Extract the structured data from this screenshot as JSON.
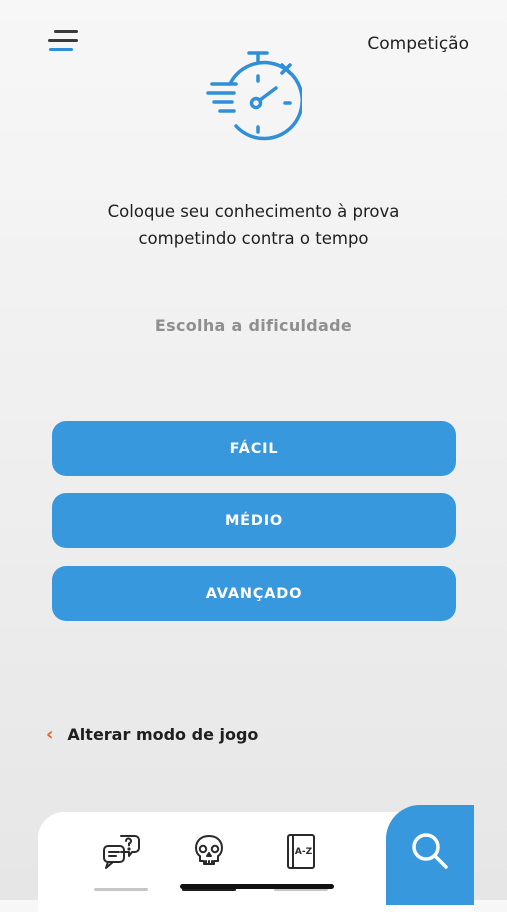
{
  "header": {
    "mode_title": "Competição",
    "menu_icon": "menu-icon"
  },
  "hero": {
    "icon": "stopwatch-icon",
    "tagline_line1": "Coloque seu conhecimento à prova",
    "tagline_line2": "competindo contra o tempo"
  },
  "difficulty": {
    "label": "Escolha a dificuldade",
    "options": [
      {
        "label": "FÁCIL"
      },
      {
        "label": "MÉDIO"
      },
      {
        "label": "AVANÇADO"
      }
    ]
  },
  "footer_link": {
    "icon": "chevron-left-icon",
    "label": "Alterar modo de jogo"
  },
  "bottom_nav": {
    "items": [
      {
        "icon": "quiz-chat-icon"
      },
      {
        "icon": "skull-icon"
      },
      {
        "icon": "dictionary-icon",
        "icon_text": "A-Z"
      }
    ],
    "search_icon": "search-icon"
  },
  "colors": {
    "accent": "#3798de",
    "link_chevron": "#e5602a",
    "muted_text": "#8f8f8f"
  }
}
